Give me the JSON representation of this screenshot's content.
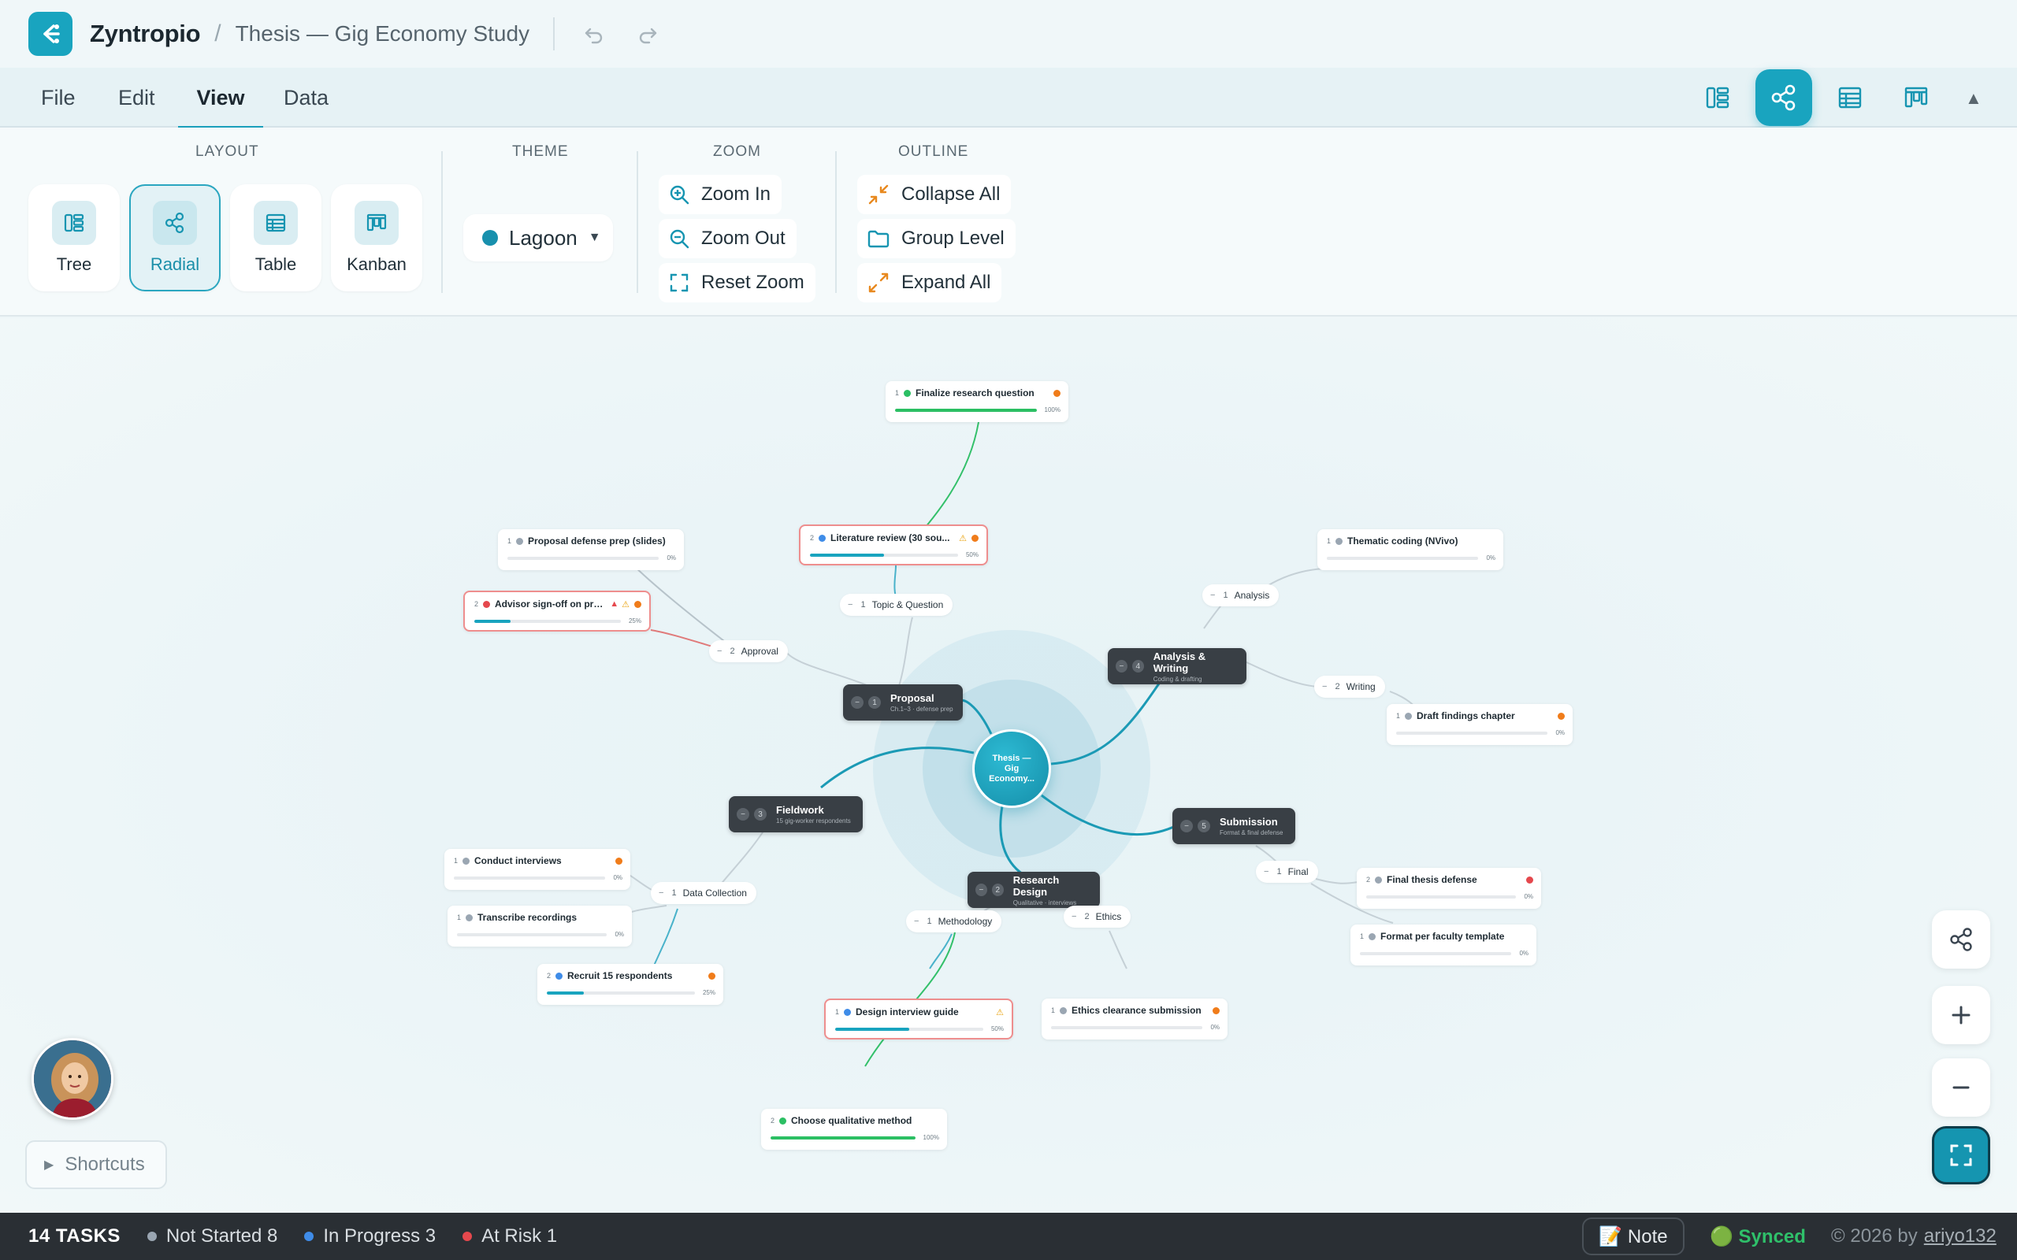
{
  "header": {
    "brand": "Zyntropio",
    "separator": "/",
    "doc_title": "Thesis — Gig Economy Study"
  },
  "menu": {
    "file": "File",
    "edit": "Edit",
    "view": "View",
    "data": "Data",
    "active": "View"
  },
  "ribbon": {
    "layout_label": "LAYOUT",
    "layouts": [
      "Tree",
      "Radial",
      "Table",
      "Kanban"
    ],
    "active_layout": "Radial",
    "theme_label": "THEME",
    "theme_value": "Lagoon",
    "zoom_label": "ZOOM",
    "zoom_in": "Zoom In",
    "zoom_out": "Zoom Out",
    "reset_zoom": "Reset Zoom",
    "outline_label": "OUTLINE",
    "collapse_all": "Collapse All",
    "group_level": "Group Level",
    "expand_all": "Expand All"
  },
  "colors": {
    "accent": "#19a4bf",
    "done": "#2bbf63",
    "in_progress": "#3f8ce8",
    "not_started": "#9aa6b2",
    "at_risk": "#e5484d",
    "priority": "#f07c1a"
  },
  "mindmap": {
    "root": "Thesis — Gig Economy...",
    "phases": [
      {
        "num": "1",
        "title": "Proposal",
        "sub": "Ch.1–3 · defense prep"
      },
      {
        "num": "2",
        "title": "Research Design",
        "sub": "Qualitative · interviews"
      },
      {
        "num": "3",
        "title": "Fieldwork",
        "sub": "15 gig-worker respondents"
      },
      {
        "num": "4",
        "title": "Analysis & Writing",
        "sub": "Coding & drafting"
      },
      {
        "num": "5",
        "title": "Submission",
        "sub": "Format & final defense"
      }
    ],
    "groups": [
      {
        "num": "1",
        "label": "Topic & Question"
      },
      {
        "num": "2",
        "label": "Approval"
      },
      {
        "num": "1",
        "label": "Methodology"
      },
      {
        "num": "2",
        "label": "Ethics"
      },
      {
        "num": "1",
        "label": "Data Collection"
      },
      {
        "num": "1",
        "label": "Analysis"
      },
      {
        "num": "2",
        "label": "Writing"
      },
      {
        "num": "1",
        "label": "Final"
      }
    ],
    "collapse_mark": "−",
    "tasks": [
      {
        "num": "1",
        "name": "Finalize research question",
        "status": "done",
        "pct": "100%",
        "progress": 1.0,
        "priority": true,
        "risk": false,
        "warn": false
      },
      {
        "num": "2",
        "name": "Literature review (30 sou...",
        "status": "in_progress",
        "pct": "50%",
        "progress": 0.5,
        "priority": true,
        "risk": true,
        "warn": true
      },
      {
        "num": "1",
        "name": "Proposal defense prep (slides)",
        "status": "not_started",
        "pct": "0%",
        "progress": 0,
        "priority": false,
        "risk": false,
        "warn": false
      },
      {
        "num": "2",
        "name": "Advisor sign-off on pro...",
        "status": "at_risk",
        "pct": "25%",
        "progress": 0.25,
        "priority": true,
        "risk": true,
        "warn": true
      },
      {
        "num": "1",
        "name": "Design interview guide",
        "status": "in_progress",
        "pct": "50%",
        "progress": 0.5,
        "priority": false,
        "risk": true,
        "warn": true
      },
      {
        "num": "2",
        "name": "Choose qualitative method",
        "status": "done",
        "pct": "100%",
        "progress": 1.0,
        "priority": false,
        "risk": false,
        "warn": false
      },
      {
        "num": "1",
        "name": "Ethics clearance submission",
        "status": "not_started",
        "pct": "0%",
        "progress": 0,
        "priority": true,
        "risk": false,
        "warn": false
      },
      {
        "num": "1",
        "name": "Conduct interviews",
        "status": "not_started",
        "pct": "0%",
        "progress": 0,
        "priority": true,
        "risk": false,
        "warn": false
      },
      {
        "num": "1",
        "name": "Transcribe recordings",
        "status": "not_started",
        "pct": "0%",
        "progress": 0,
        "priority": false,
        "risk": false,
        "warn": false
      },
      {
        "num": "2",
        "name": "Recruit 15 respondents",
        "status": "in_progress",
        "pct": "25%",
        "progress": 0.25,
        "priority": true,
        "risk": false,
        "warn": false
      },
      {
        "num": "1",
        "name": "Thematic coding (NVivo)",
        "status": "not_started",
        "pct": "0%",
        "progress": 0,
        "priority": false,
        "risk": false,
        "warn": false
      },
      {
        "num": "1",
        "name": "Draft findings chapter",
        "status": "not_started",
        "pct": "0%",
        "progress": 0,
        "priority": true,
        "risk": false,
        "warn": false
      },
      {
        "num": "2",
        "name": "Final thesis defense",
        "status": "not_started",
        "pct": "0%",
        "progress": 0,
        "priority": true,
        "priority_color": "at_risk",
        "risk": false,
        "warn": false
      },
      {
        "num": "1",
        "name": "Format per faculty template",
        "status": "not_started",
        "pct": "0%",
        "progress": 0,
        "priority": false,
        "risk": false,
        "warn": false
      }
    ]
  },
  "shortcuts": "Shortcuts",
  "status": {
    "tasks": "14 TASKS",
    "not_started": "Not Started 8",
    "in_progress": "In Progress 3",
    "at_risk": "At Risk 1",
    "note": "📝 Note",
    "synced": "🟢 Synced",
    "copyright": "© 2026 by",
    "author": "ariyo132"
  }
}
